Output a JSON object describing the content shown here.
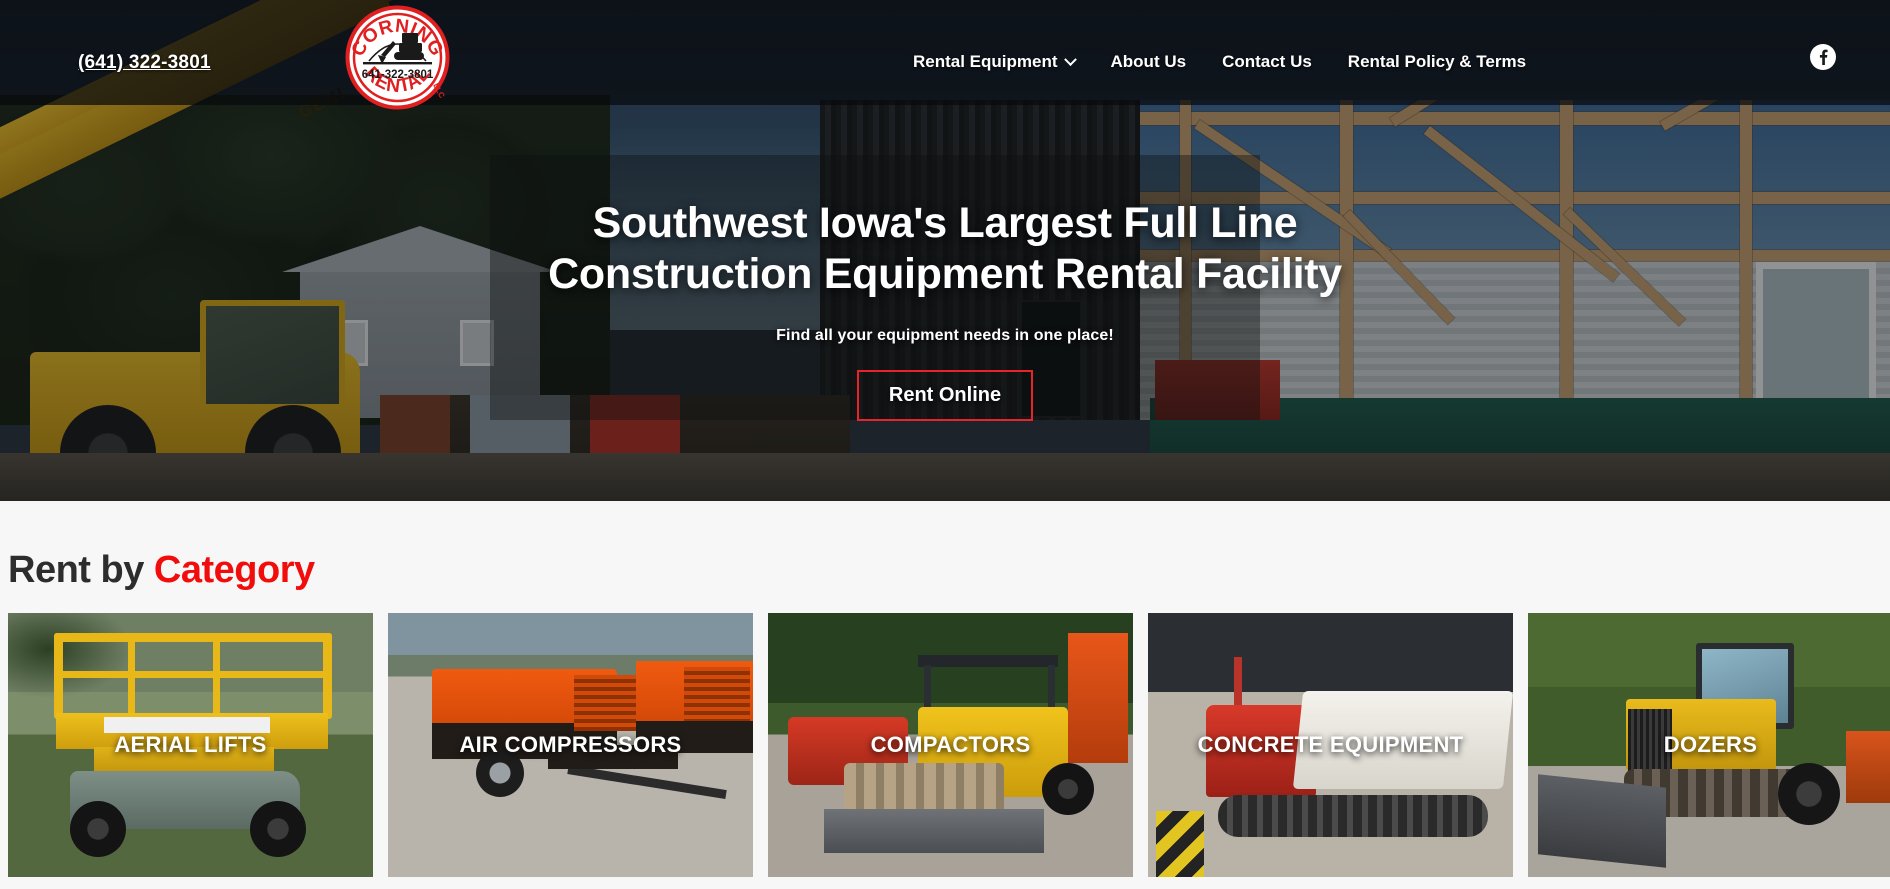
{
  "header": {
    "phone": "(641) 322-3801",
    "logo": {
      "top_arc_text": "CORNING",
      "bottom_arc_text": "RENTAL",
      "suffix": "LLC",
      "center_phone": "641-322-3801"
    },
    "nav": [
      {
        "label": "Rental Equipment",
        "has_dropdown": true
      },
      {
        "label": "About Us",
        "has_dropdown": false
      },
      {
        "label": "Contact Us",
        "has_dropdown": false
      },
      {
        "label": "Rental Policy & Terms",
        "has_dropdown": false
      }
    ],
    "social": {
      "facebook_label": "f"
    }
  },
  "hero": {
    "title": "Southwest Iowa's Largest Full Line Construction Equipment Rental Facility",
    "subtitle": "Find all your equipment needs in one place!",
    "cta_label": "Rent Online"
  },
  "categories": {
    "heading_plain": "Rent by ",
    "heading_accent": "Category",
    "cards": [
      {
        "label": "AERIAL LIFTS"
      },
      {
        "label": "AIR COMPRESSORS"
      },
      {
        "label": "COMPACTORS"
      },
      {
        "label": "CONCRETE EQUIPMENT"
      },
      {
        "label": "DOZERS"
      }
    ]
  },
  "colors": {
    "accent_red": "#f20d0d",
    "button_border_red": "#e8232a",
    "heading_dark": "#2d2d2d",
    "section_bg": "#f7f7f7",
    "text_white": "#ffffff"
  }
}
